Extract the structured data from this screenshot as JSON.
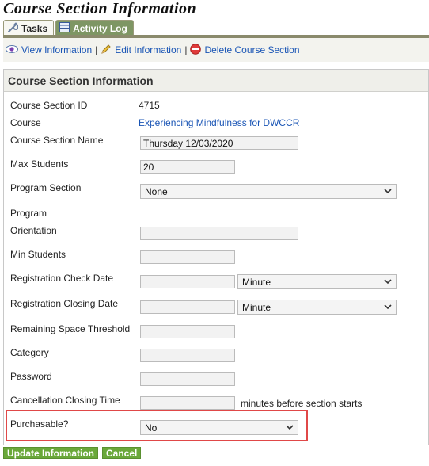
{
  "page": {
    "title": "Course Section Information"
  },
  "tabs": [
    {
      "label": "Tasks",
      "icon": "wrench-icon",
      "active": true
    },
    {
      "label": "Activity Log",
      "icon": "table-icon",
      "active": false
    }
  ],
  "actions": {
    "view_label": "View Information",
    "edit_label": "Edit Information",
    "delete_label": "Delete Course Section",
    "separator": "|"
  },
  "panel": {
    "header": "Course Section Information"
  },
  "fields": {
    "section_id": {
      "label": "Course Section ID",
      "value": "4715"
    },
    "course": {
      "label": "Course",
      "value": "Experiencing Mindfulness for DWCCR"
    },
    "section_name": {
      "label": "Course Section Name",
      "value": "Thursday 12/03/2020"
    },
    "max_students": {
      "label": "Max Students",
      "value": "20"
    },
    "program_section": {
      "label": "Program Section",
      "value": "None"
    },
    "program": {
      "label": "Program"
    },
    "orientation": {
      "label": "Orientation",
      "value": ""
    },
    "min_students": {
      "label": "Min Students",
      "value": ""
    },
    "reg_check_date": {
      "label": "Registration Check Date",
      "value": "",
      "unit": "Minute"
    },
    "reg_closing_date": {
      "label": "Registration Closing Date",
      "value": "",
      "unit": "Minute"
    },
    "remaining_space": {
      "label": "Remaining Space Threshold",
      "value": ""
    },
    "category": {
      "label": "Category",
      "value": ""
    },
    "password": {
      "label": "Password",
      "value": ""
    },
    "cancellation_time": {
      "label": "Cancellation Closing Time",
      "value": "",
      "suffix": "minutes before section starts"
    },
    "purchasable": {
      "label": "Purchasable?",
      "value": "No"
    }
  },
  "buttons": {
    "update_label": "Update Information",
    "cancel_label": "Cancel"
  },
  "colors": {
    "link": "#1a55b5",
    "button": "#6aa83a",
    "tab_inactive": "#7e9664",
    "highlight": "#e04848"
  }
}
